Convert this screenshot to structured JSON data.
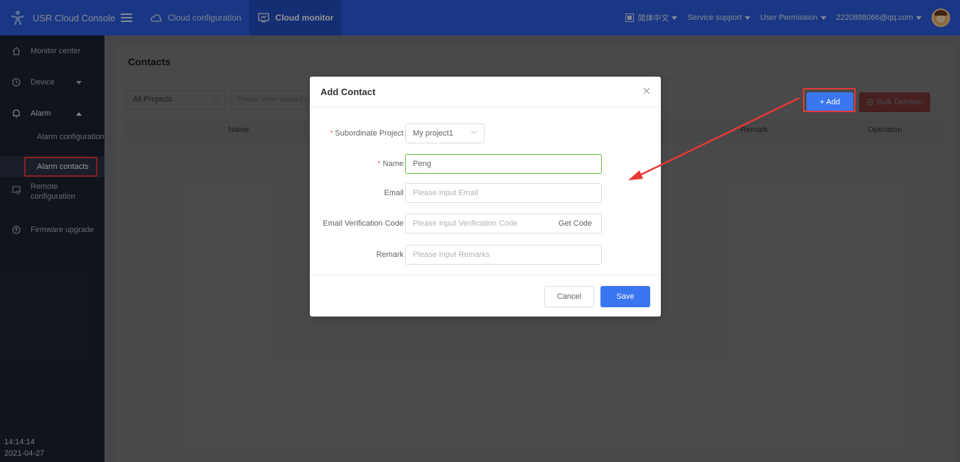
{
  "topbar": {
    "title": "USR Cloud Console",
    "nav": [
      {
        "label": "Cloud configuration",
        "icon": "cloud-icon"
      },
      {
        "label": "Cloud monitor",
        "icon": "monitor-icon",
        "active": true
      }
    ],
    "language": "简体中文",
    "service_support": "Service support",
    "user_permission": "User Permission",
    "account": "2220898066@qq.com"
  },
  "sidebar": {
    "items": [
      {
        "label": "Monitor center",
        "icon": "home-icon"
      },
      {
        "label": "Device",
        "icon": "device-icon"
      },
      {
        "label": "Alarm",
        "icon": "bell-icon"
      }
    ],
    "sub_alarm_configuration": "Alarm configuration",
    "sub_alarm_contacts": "Alarm contacts",
    "remote_configuration": "Remote configuration",
    "firmware_upgrade": "Firmware upgrade",
    "time": "14:14:14",
    "date": "2021-04-27"
  },
  "page": {
    "title": "Contacts",
    "project_filter": "All Projects",
    "search_placeholder": "Please enter contact na",
    "add_label": "+ Add",
    "bulk_delete_label": "Bulk Deletion",
    "columns": {
      "name": "Name",
      "remark": "Remark",
      "operation": "Operation"
    }
  },
  "modal": {
    "title": "Add Contact",
    "fields": {
      "project": {
        "label": "Subordinate Project",
        "value": "My project1"
      },
      "name": {
        "label": "Name",
        "value": "Peng"
      },
      "email": {
        "label": "Email",
        "placeholder": "Please Input Email"
      },
      "code": {
        "label": "Email Verification Code",
        "placeholder": "Please Input Verification Code",
        "get_code": "Get Code"
      },
      "remark": {
        "label": "Remark",
        "placeholder": "Please Input Remarks"
      }
    },
    "cancel": "Cancel",
    "save": "Save"
  },
  "colors": {
    "topbar": "#2b5fe3",
    "sidebar": "#1d2433",
    "primary": "#3a76f0",
    "danger": "#f56c6c",
    "highlight": "#e53935"
  }
}
